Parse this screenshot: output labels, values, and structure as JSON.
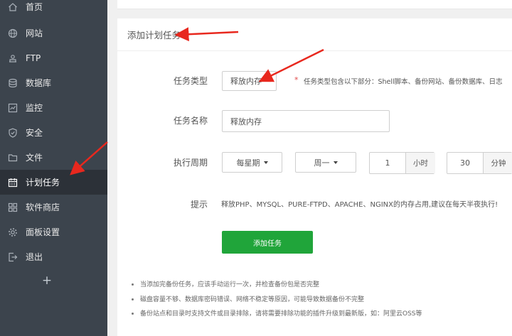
{
  "sidebar": {
    "items": [
      {
        "label": "首页",
        "icon": "home-icon"
      },
      {
        "label": "网站",
        "icon": "globe-icon"
      },
      {
        "label": "FTP",
        "icon": "ftp-icon"
      },
      {
        "label": "数据库",
        "icon": "database-icon"
      },
      {
        "label": "监控",
        "icon": "monitor-icon"
      },
      {
        "label": "安全",
        "icon": "shield-icon"
      },
      {
        "label": "文件",
        "icon": "folder-icon"
      },
      {
        "label": "计划任务",
        "icon": "calendar-icon",
        "active": true
      },
      {
        "label": "软件商店",
        "icon": "apps-icon"
      },
      {
        "label": "面板设置",
        "icon": "gear-icon"
      },
      {
        "label": "退出",
        "icon": "logout-icon"
      }
    ],
    "add_symbol": "+"
  },
  "form": {
    "title": "添加计划任务",
    "task_type_label": "任务类型",
    "task_type_value": "释放内存",
    "task_type_hint_star": "*",
    "task_type_hint": "任务类型包含以下部分：Shell脚本、备份网站、备份数据库、日志切割、释放内存",
    "task_name_label": "任务名称",
    "task_name_value": "释放内存",
    "cycle_label": "执行周期",
    "cycle_type": "每星期",
    "cycle_weekday": "周一",
    "hour_value": "1",
    "hour_unit": "小时",
    "minute_value": "30",
    "minute_unit": "分钟",
    "tip_label": "提示",
    "tip_text": "释放PHP、MYSQL、PURE-FTPD、APACHE、NGINX的内存占用,建议在每天半夜执行!",
    "submit_label": "添加任务"
  },
  "notes": [
    "当添加完备份任务，应该手动运行一次，并检查备份包是否完整",
    "磁盘容量不够、数据库密码错误、网络不稳定等原因，可能导致数据备份不完整",
    "备份站点和目录时支持文件或目录排除，请将需要排除功能的插件升级到最新版，如：阿里云OSS等"
  ],
  "colors": {
    "sidebar_bg": "#3c444d",
    "sidebar_active_bg": "#2c3138",
    "accent_green": "#20a53a",
    "annotation_red": "#e8281e"
  }
}
